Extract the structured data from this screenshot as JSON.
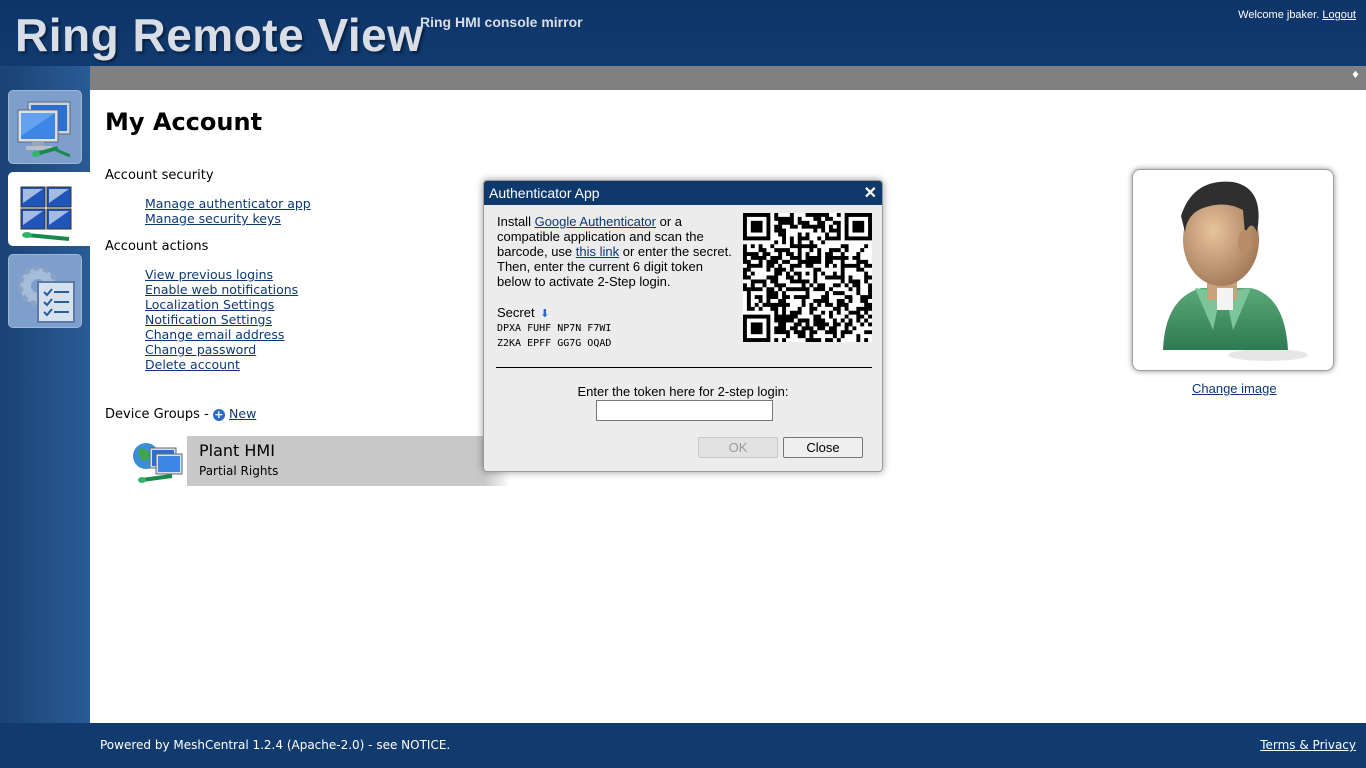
{
  "header": {
    "title": "Ring Remote View",
    "subtitle": "Ring HMI console mirror",
    "welcome_text": "Welcome jbaker.",
    "logout_label": "Logout"
  },
  "sidebar": {
    "items": [
      {
        "name": "devices",
        "icon": "computers-icon"
      },
      {
        "name": "my-account",
        "icon": "account-computers-icon",
        "active": true
      },
      {
        "name": "settings",
        "icon": "settings-checklist-icon"
      }
    ]
  },
  "topbar": {
    "toggle_glyph": "♦"
  },
  "main": {
    "page_title": "My Account",
    "account_security": {
      "heading": "Account security",
      "links": [
        "Manage authenticator app",
        "Manage security keys"
      ]
    },
    "account_actions": {
      "heading": "Account actions",
      "links": [
        "View previous logins",
        "Enable web notifications",
        "Localization Settings",
        "Notification Settings",
        "Change email address",
        "Change password",
        "Delete account"
      ]
    },
    "device_groups": {
      "heading": "Device Groups -",
      "new_label": "New",
      "groups": [
        {
          "name": "Plant HMI",
          "rights": "Partial Rights"
        }
      ]
    },
    "change_image_label": "Change image"
  },
  "dialog": {
    "title": "Authenticator App",
    "close_glyph": "✕",
    "install_prefix": "Install ",
    "google_auth_link": "Google Authenticator",
    "install_mid": " or a compatible application and scan the barcode, use ",
    "this_link": "this link",
    "install_suffix": " or enter the secret. Then, enter the current 6 digit token below to activate 2-Step login.",
    "secret_label": "Secret",
    "secret_line1": "DPXA FUHF NP7N F7WI",
    "secret_line2": "Z2KA EPFF GG7G OQAD",
    "token_label": "Enter the token here for 2-step login:",
    "token_value": "",
    "ok_label": "OK",
    "close_label": "Close"
  },
  "footer": {
    "text": "Powered by MeshCentral 1.2.4 (Apache-2.0) - see NOTICE.",
    "link": "Terms & Privacy"
  },
  "colors": {
    "header_bg": "#0e3567",
    "link": "#0d3874",
    "dialog_title_bg": "#0f386c",
    "topbar_gray": "#808080"
  }
}
